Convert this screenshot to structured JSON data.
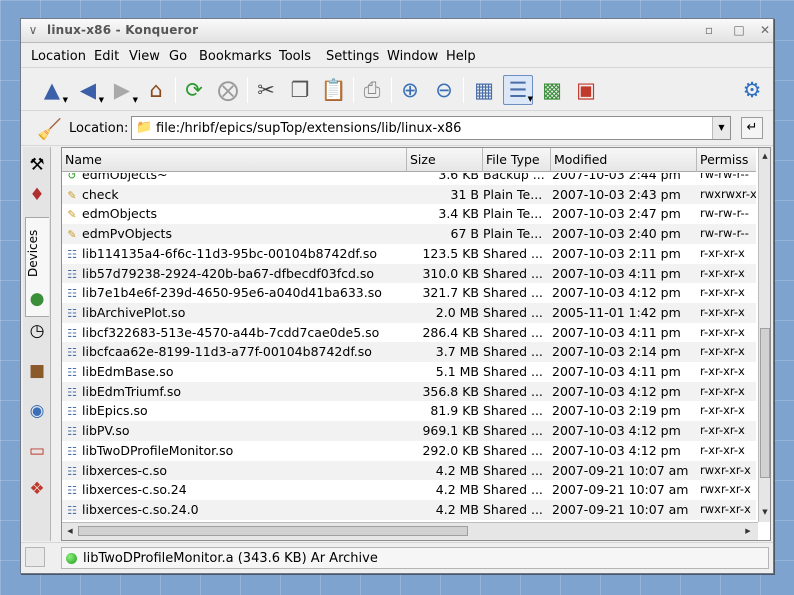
{
  "window": {
    "title": "linux-x86 - Konqueror",
    "sysmenu_icon": "konqueror-menu-icon",
    "buttons": [
      "minimize",
      "maximize",
      "close"
    ]
  },
  "menubar": {
    "items": [
      "Location",
      "Edit",
      "View",
      "Go",
      "Bookmarks",
      "Tools",
      "Settings",
      "Window",
      "Help"
    ]
  },
  "toolbar": {
    "buttons": [
      "up",
      "back",
      "forward",
      "home",
      "reload",
      "stop",
      "cut",
      "copy",
      "paste",
      "print",
      "zoom-in",
      "zoom-out",
      "icon-view",
      "detailed-list-view",
      "multi-column-view",
      "text-view",
      "configure"
    ],
    "active_view": "detailed-list-view"
  },
  "location": {
    "label": "Location:",
    "value": "file:/hribf/epics/supTop/extensions/lib/linux-x86"
  },
  "sidebar": {
    "tab_label": "Devices"
  },
  "table": {
    "columns": [
      "Name",
      "Size",
      "File Type",
      "Modified",
      "Permiss"
    ],
    "rows": [
      {
        "icon": "backup",
        "name": "edmObjects~",
        "size": "3.6 KB",
        "type": "Backup ...",
        "modified": "2007-10-03 2:44 pm",
        "perms": "rw-rw-r--"
      },
      {
        "icon": "text",
        "name": "check",
        "size": "31 B",
        "type": "Plain Te...",
        "modified": "2007-10-03 2:43 pm",
        "perms": "rwxrwxr-x"
      },
      {
        "icon": "text",
        "name": "edmObjects",
        "size": "3.4 KB",
        "type": "Plain Te...",
        "modified": "2007-10-03 2:47 pm",
        "perms": "rw-rw-r--"
      },
      {
        "icon": "text",
        "name": "edmPvObjects",
        "size": "67 B",
        "type": "Plain Te...",
        "modified": "2007-10-03 2:40 pm",
        "perms": "rw-rw-r--"
      },
      {
        "icon": "lib",
        "name": "lib114135a4-6f6c-11d3-95bc-00104b8742df.so",
        "size": "123.5 KB",
        "type": "Shared ...",
        "modified": "2007-10-03 2:11 pm",
        "perms": "r-xr-xr-x"
      },
      {
        "icon": "lib",
        "name": "lib57d79238-2924-420b-ba67-dfbecdf03fcd.so",
        "size": "310.0 KB",
        "type": "Shared ...",
        "modified": "2007-10-03 4:11 pm",
        "perms": "r-xr-xr-x"
      },
      {
        "icon": "lib",
        "name": "lib7e1b4e6f-239d-4650-95e6-a040d41ba633.so",
        "size": "321.7 KB",
        "type": "Shared ...",
        "modified": "2007-10-03 4:12 pm",
        "perms": "r-xr-xr-x"
      },
      {
        "icon": "lib",
        "name": "libArchivePlot.so",
        "size": "2.0 MB",
        "type": "Shared ...",
        "modified": "2005-11-01 1:42 pm",
        "perms": "r-xr-xr-x"
      },
      {
        "icon": "lib",
        "name": "libcf322683-513e-4570-a44b-7cdd7cae0de5.so",
        "size": "286.4 KB",
        "type": "Shared ...",
        "modified": "2007-10-03 4:11 pm",
        "perms": "r-xr-xr-x"
      },
      {
        "icon": "lib",
        "name": "libcfcaa62e-8199-11d3-a77f-00104b8742df.so",
        "size": "3.7 MB",
        "type": "Shared ...",
        "modified": "2007-10-03 2:14 pm",
        "perms": "r-xr-xr-x"
      },
      {
        "icon": "lib",
        "name": "libEdmBase.so",
        "size": "5.1 MB",
        "type": "Shared ...",
        "modified": "2007-10-03 4:11 pm",
        "perms": "r-xr-xr-x"
      },
      {
        "icon": "lib",
        "name": "libEdmTriumf.so",
        "size": "356.8 KB",
        "type": "Shared ...",
        "modified": "2007-10-03 4:12 pm",
        "perms": "r-xr-xr-x"
      },
      {
        "icon": "lib",
        "name": "libEpics.so",
        "size": "81.9 KB",
        "type": "Shared ...",
        "modified": "2007-10-03 2:19 pm",
        "perms": "r-xr-xr-x"
      },
      {
        "icon": "lib",
        "name": "libPV.so",
        "size": "969.1 KB",
        "type": "Shared ...",
        "modified": "2007-10-03 4:12 pm",
        "perms": "r-xr-xr-x"
      },
      {
        "icon": "lib",
        "name": "libTwoDProfileMonitor.so",
        "size": "292.0 KB",
        "type": "Shared ...",
        "modified": "2007-10-03 4:12 pm",
        "perms": "r-xr-xr-x"
      },
      {
        "icon": "lib",
        "name": "libxerces-c.so",
        "size": "4.2 MB",
        "type": "Shared ...",
        "modified": "2007-09-21 10:07 am",
        "perms": "rwxr-xr-x"
      },
      {
        "icon": "lib",
        "name": "libxerces-c.so.24",
        "size": "4.2 MB",
        "type": "Shared ...",
        "modified": "2007-09-21 10:07 am",
        "perms": "rwxr-xr-x"
      },
      {
        "icon": "lib",
        "name": "libxerces-c.so.24.0",
        "size": "4.2 MB",
        "type": "Shared ...",
        "modified": "2007-09-21 10:07 am",
        "perms": "rwxr-xr-x"
      }
    ]
  },
  "statusbar": {
    "text": "libTwoDProfileMonitor.a (343.6 KB)  Ar Archive"
  }
}
